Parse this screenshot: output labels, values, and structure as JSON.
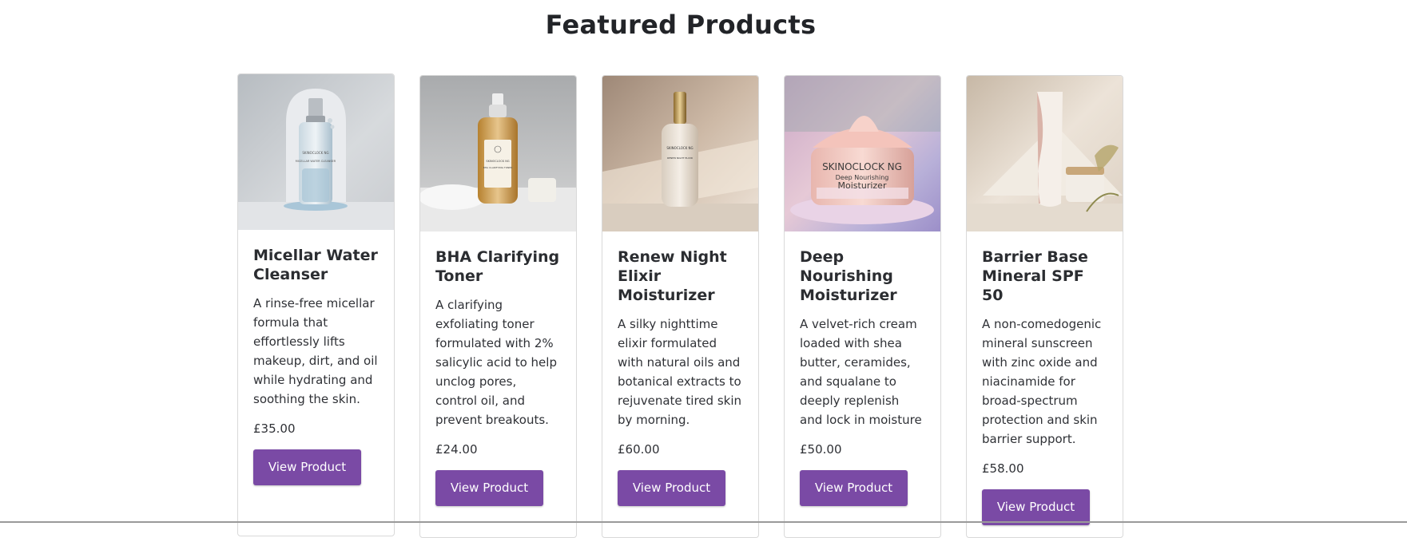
{
  "section": {
    "title": "Featured Products"
  },
  "products": [
    {
      "name": "Micellar Water Cleanser",
      "description": "A rinse-free micellar formula that effortlessly lifts makeup, dirt, and oil while hydrating and soothing the skin.",
      "price": "£35.00",
      "button_label": "View Product",
      "image": "micellar-water-bottle-image",
      "bottle_brand": "SKINOCLOCK NG",
      "bottle_label": "MICELLAR WATER CLEANSER"
    },
    {
      "name": "BHA Clarifying Toner",
      "description": "A clarifying exfoliating toner formulated with 2% salicylic acid to help unclog pores, control oil, and prevent breakouts.",
      "price": "£24.00",
      "button_label": "View Product",
      "image": "toner-bottle-image",
      "bottle_brand": "SKINOCLOCK NG",
      "bottle_label": "BHA CLARIFYING TONER"
    },
    {
      "name": "Renew Night Elixir Moisturizer",
      "description": "A silky nighttime elixir formulated with natural oils and botanical extracts to rejuvenate tired skin by morning.",
      "price": "£60.00",
      "button_label": "View Product",
      "image": "night-elixir-bottle-image",
      "bottle_brand": "SKINOCLOCK NG",
      "bottle_label": "RENEW NIGHT ELIXIR"
    },
    {
      "name": "Deep Nourishing Moisturizer",
      "description": "A velvet-rich cream loaded with shea butter, ceramides, and squalane to deeply replenish and lock in moisture",
      "price": "£50.00",
      "button_label": "View Product",
      "image": "cream-jar-image",
      "bottle_brand": "SKINOCLOCK NG",
      "bottle_label": "Deep Nourishing",
      "bottle_label2": "Moisturizer"
    },
    {
      "name": "Barrier Base Mineral SPF 50",
      "description": "A non-comedogenic mineral sunscreen with zinc oxide and niacinamide for broad-spectrum protection and skin barrier support.",
      "price": "£58.00",
      "button_label": "View Product",
      "image": "sunscreen-tube-image"
    }
  ],
  "colors": {
    "button": "#7a4aa5",
    "border": "#d9d9d9"
  }
}
